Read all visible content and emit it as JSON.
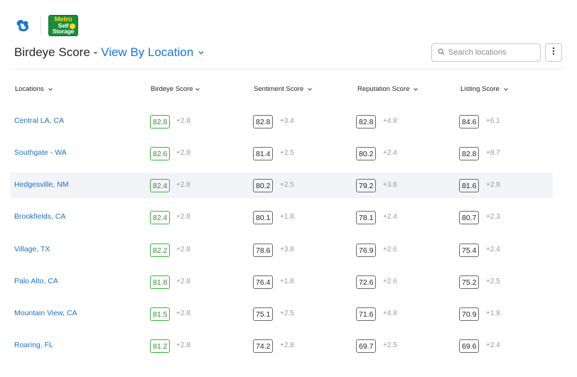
{
  "brand": {
    "birdeye_logo_icon": "birdeye-b-icon",
    "customer_logo": {
      "line1": "Metro",
      "line2": "Self",
      "line3": "Storage"
    }
  },
  "header": {
    "title": "Birdeye Score -",
    "view_selector": "View By Location",
    "search_placeholder": "Search locations",
    "accent_color": "#1976d2"
  },
  "table": {
    "columns": [
      "Locations",
      "Birdeye Score",
      "Sentiment Score",
      "Reputation Score",
      "Listing Score"
    ],
    "rows": [
      {
        "location": "Central LA, CA",
        "birdeye": "82.8",
        "birdeye_delta": "+2.8",
        "sentiment": "82.8",
        "sentiment_delta": "+3.4",
        "reputation": "82.8",
        "reputation_delta": "+4.8",
        "listing": "84.6",
        "listing_delta": "+6.1"
      },
      {
        "location": "Southgate - WA",
        "birdeye": "82.6",
        "birdeye_delta": "+2.8",
        "sentiment": "81.4",
        "sentiment_delta": "+2.5",
        "reputation": "80.2",
        "reputation_delta": "+2.4",
        "listing": "82.8",
        "listing_delta": "+8.7"
      },
      {
        "location": "Hedgesville, NM",
        "birdeye": "82.4",
        "birdeye_delta": "+2.8",
        "sentiment": "80.2",
        "sentiment_delta": "+2.5",
        "reputation": "79.2",
        "reputation_delta": "+3.8",
        "listing": "81.6",
        "listing_delta": "+2.8"
      },
      {
        "location": "Brookfields, CA",
        "birdeye": "82.4",
        "birdeye_delta": "+2.8",
        "sentiment": "80.1",
        "sentiment_delta": "+1.8",
        "reputation": "78.1",
        "reputation_delta": "+2.4",
        "listing": "80.7",
        "listing_delta": "+2.3"
      },
      {
        "location": "Village, TX",
        "birdeye": "82.2",
        "birdeye_delta": "+2.8",
        "sentiment": "78.6",
        "sentiment_delta": "+3.8",
        "reputation": "76.9",
        "reputation_delta": "+2.6",
        "listing": "75.4",
        "listing_delta": "+2.4"
      },
      {
        "location": "Palo Alto, CA",
        "birdeye": "81.8",
        "birdeye_delta": "+2.8",
        "sentiment": "76.4",
        "sentiment_delta": "+1.8",
        "reputation": "72.6",
        "reputation_delta": "+2.6",
        "listing": "75.2",
        "listing_delta": "+2.5"
      },
      {
        "location": "Mountain View, CA",
        "birdeye": "81.5",
        "birdeye_delta": "+2.8",
        "sentiment": "75.1",
        "sentiment_delta": "+2.5",
        "reputation": "71.6",
        "reputation_delta": "+4.8",
        "listing": "70.9",
        "listing_delta": "+1.8"
      },
      {
        "location": "Roaring, FL",
        "birdeye": "81.2",
        "birdeye_delta": "+2.8",
        "sentiment": "74.2",
        "sentiment_delta": "+2.8",
        "reputation": "69.7",
        "reputation_delta": "+2.5",
        "listing": "69.6",
        "listing_delta": "+2.4"
      }
    ],
    "highlighted_row": 2
  }
}
